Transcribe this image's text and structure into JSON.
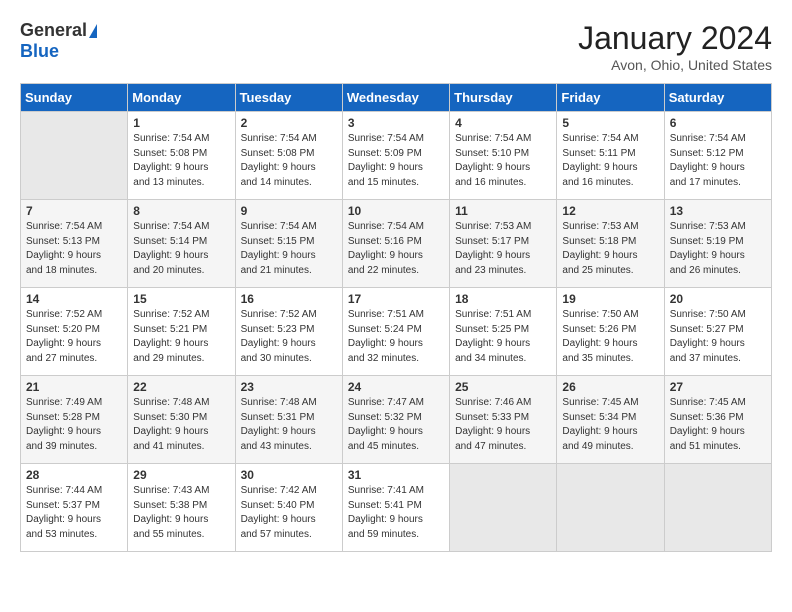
{
  "header": {
    "logo_general": "General",
    "logo_blue": "Blue",
    "title": "January 2024",
    "subtitle": "Avon, Ohio, United States"
  },
  "days_of_week": [
    "Sunday",
    "Monday",
    "Tuesday",
    "Wednesday",
    "Thursday",
    "Friday",
    "Saturday"
  ],
  "weeks": [
    [
      {
        "num": "",
        "info": ""
      },
      {
        "num": "1",
        "info": "Sunrise: 7:54 AM\nSunset: 5:08 PM\nDaylight: 9 hours\nand 13 minutes."
      },
      {
        "num": "2",
        "info": "Sunrise: 7:54 AM\nSunset: 5:08 PM\nDaylight: 9 hours\nand 14 minutes."
      },
      {
        "num": "3",
        "info": "Sunrise: 7:54 AM\nSunset: 5:09 PM\nDaylight: 9 hours\nand 15 minutes."
      },
      {
        "num": "4",
        "info": "Sunrise: 7:54 AM\nSunset: 5:10 PM\nDaylight: 9 hours\nand 16 minutes."
      },
      {
        "num": "5",
        "info": "Sunrise: 7:54 AM\nSunset: 5:11 PM\nDaylight: 9 hours\nand 16 minutes."
      },
      {
        "num": "6",
        "info": "Sunrise: 7:54 AM\nSunset: 5:12 PM\nDaylight: 9 hours\nand 17 minutes."
      }
    ],
    [
      {
        "num": "7",
        "info": "Sunrise: 7:54 AM\nSunset: 5:13 PM\nDaylight: 9 hours\nand 18 minutes."
      },
      {
        "num": "8",
        "info": "Sunrise: 7:54 AM\nSunset: 5:14 PM\nDaylight: 9 hours\nand 20 minutes."
      },
      {
        "num": "9",
        "info": "Sunrise: 7:54 AM\nSunset: 5:15 PM\nDaylight: 9 hours\nand 21 minutes."
      },
      {
        "num": "10",
        "info": "Sunrise: 7:54 AM\nSunset: 5:16 PM\nDaylight: 9 hours\nand 22 minutes."
      },
      {
        "num": "11",
        "info": "Sunrise: 7:53 AM\nSunset: 5:17 PM\nDaylight: 9 hours\nand 23 minutes."
      },
      {
        "num": "12",
        "info": "Sunrise: 7:53 AM\nSunset: 5:18 PM\nDaylight: 9 hours\nand 25 minutes."
      },
      {
        "num": "13",
        "info": "Sunrise: 7:53 AM\nSunset: 5:19 PM\nDaylight: 9 hours\nand 26 minutes."
      }
    ],
    [
      {
        "num": "14",
        "info": "Sunrise: 7:52 AM\nSunset: 5:20 PM\nDaylight: 9 hours\nand 27 minutes."
      },
      {
        "num": "15",
        "info": "Sunrise: 7:52 AM\nSunset: 5:21 PM\nDaylight: 9 hours\nand 29 minutes."
      },
      {
        "num": "16",
        "info": "Sunrise: 7:52 AM\nSunset: 5:23 PM\nDaylight: 9 hours\nand 30 minutes."
      },
      {
        "num": "17",
        "info": "Sunrise: 7:51 AM\nSunset: 5:24 PM\nDaylight: 9 hours\nand 32 minutes."
      },
      {
        "num": "18",
        "info": "Sunrise: 7:51 AM\nSunset: 5:25 PM\nDaylight: 9 hours\nand 34 minutes."
      },
      {
        "num": "19",
        "info": "Sunrise: 7:50 AM\nSunset: 5:26 PM\nDaylight: 9 hours\nand 35 minutes."
      },
      {
        "num": "20",
        "info": "Sunrise: 7:50 AM\nSunset: 5:27 PM\nDaylight: 9 hours\nand 37 minutes."
      }
    ],
    [
      {
        "num": "21",
        "info": "Sunrise: 7:49 AM\nSunset: 5:28 PM\nDaylight: 9 hours\nand 39 minutes."
      },
      {
        "num": "22",
        "info": "Sunrise: 7:48 AM\nSunset: 5:30 PM\nDaylight: 9 hours\nand 41 minutes."
      },
      {
        "num": "23",
        "info": "Sunrise: 7:48 AM\nSunset: 5:31 PM\nDaylight: 9 hours\nand 43 minutes."
      },
      {
        "num": "24",
        "info": "Sunrise: 7:47 AM\nSunset: 5:32 PM\nDaylight: 9 hours\nand 45 minutes."
      },
      {
        "num": "25",
        "info": "Sunrise: 7:46 AM\nSunset: 5:33 PM\nDaylight: 9 hours\nand 47 minutes."
      },
      {
        "num": "26",
        "info": "Sunrise: 7:45 AM\nSunset: 5:34 PM\nDaylight: 9 hours\nand 49 minutes."
      },
      {
        "num": "27",
        "info": "Sunrise: 7:45 AM\nSunset: 5:36 PM\nDaylight: 9 hours\nand 51 minutes."
      }
    ],
    [
      {
        "num": "28",
        "info": "Sunrise: 7:44 AM\nSunset: 5:37 PM\nDaylight: 9 hours\nand 53 minutes."
      },
      {
        "num": "29",
        "info": "Sunrise: 7:43 AM\nSunset: 5:38 PM\nDaylight: 9 hours\nand 55 minutes."
      },
      {
        "num": "30",
        "info": "Sunrise: 7:42 AM\nSunset: 5:40 PM\nDaylight: 9 hours\nand 57 minutes."
      },
      {
        "num": "31",
        "info": "Sunrise: 7:41 AM\nSunset: 5:41 PM\nDaylight: 9 hours\nand 59 minutes."
      },
      {
        "num": "",
        "info": ""
      },
      {
        "num": "",
        "info": ""
      },
      {
        "num": "",
        "info": ""
      }
    ]
  ]
}
